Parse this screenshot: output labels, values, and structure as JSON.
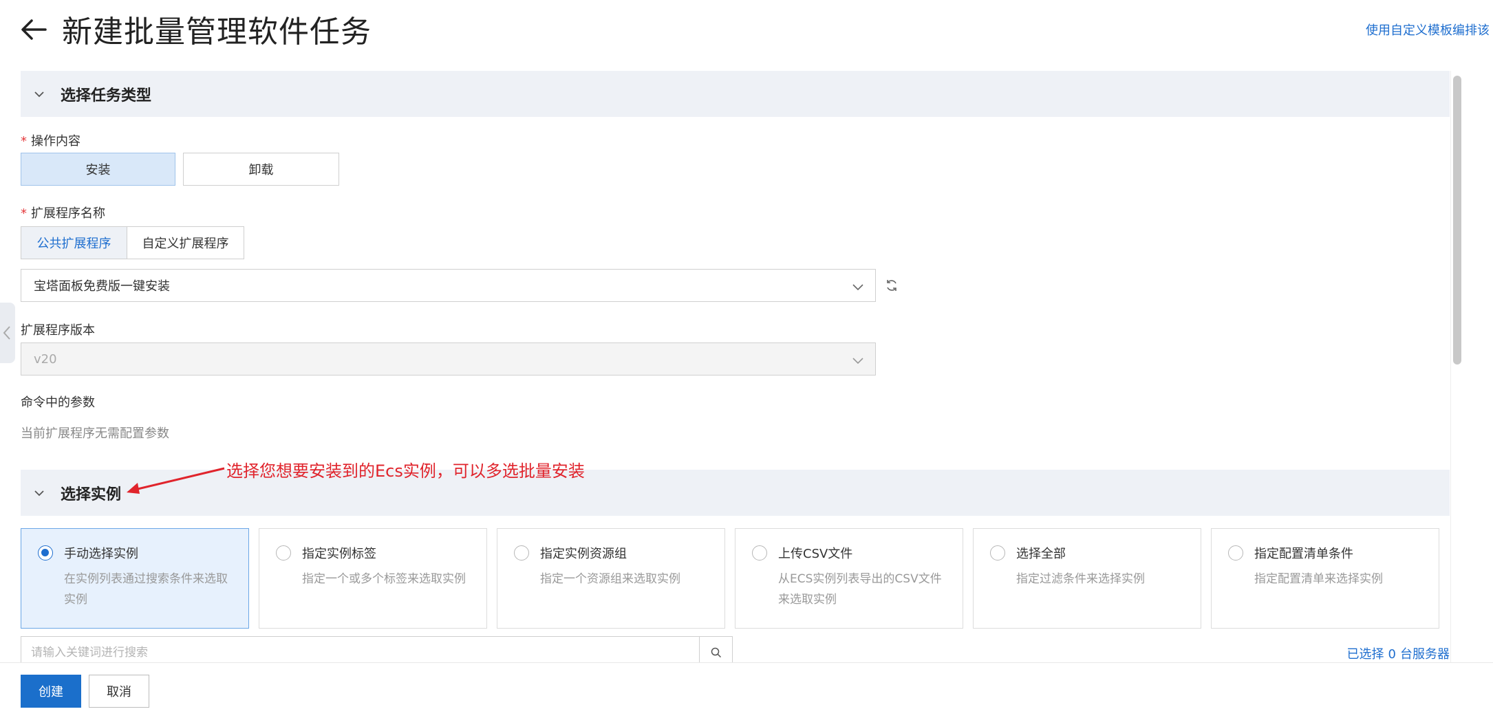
{
  "header": {
    "title": "新建批量管理软件任务",
    "template_link": "使用自定义模板编排该"
  },
  "section_task_type": {
    "title": "选择任务类型",
    "operation": {
      "label": "操作内容",
      "options": [
        "安装",
        "卸载"
      ],
      "selected": "安装"
    },
    "extension_name": {
      "label": "扩展程序名称",
      "tabs": [
        "公共扩展程序",
        "自定义扩展程序"
      ],
      "active_tab": "公共扩展程序",
      "selected_value": "宝塔面板免费版一键安装"
    },
    "extension_version": {
      "label": "扩展程序版本",
      "value": "v20"
    },
    "command_params": {
      "label": "命令中的参数",
      "hint": "当前扩展程序无需配置参数"
    }
  },
  "annotation": {
    "text": "选择您想要安装到的Ecs实例，可以多选批量安装",
    "color": "#e0242c"
  },
  "section_instances": {
    "title": "选择实例",
    "cards": [
      {
        "title": "手动选择实例",
        "desc": "在实例列表通过搜索条件来选取实例",
        "selected": true
      },
      {
        "title": "指定实例标签",
        "desc": "指定一个或多个标签来选取实例",
        "selected": false
      },
      {
        "title": "指定实例资源组",
        "desc": "指定一个资源组来选取实例",
        "selected": false
      },
      {
        "title": "上传CSV文件",
        "desc": "从ECS实例列表导出的CSV文件来选取实例",
        "selected": false
      },
      {
        "title": "选择全部",
        "desc": "指定过滤条件来选择实例",
        "selected": false
      },
      {
        "title": "指定配置清单条件",
        "desc": "指定配置清单来选择实例",
        "selected": false
      }
    ],
    "search_placeholder": "请输入关键词进行搜索",
    "selected_prefix": "已选择",
    "selected_count": "0",
    "selected_suffix": "台服务器"
  },
  "footer": {
    "create_label": "创建",
    "cancel_label": "取消"
  },
  "colors": {
    "primary": "#1b6fcb",
    "link": "#1e6ecf",
    "required": "#e4393c",
    "section_bg": "#eef1f6"
  }
}
